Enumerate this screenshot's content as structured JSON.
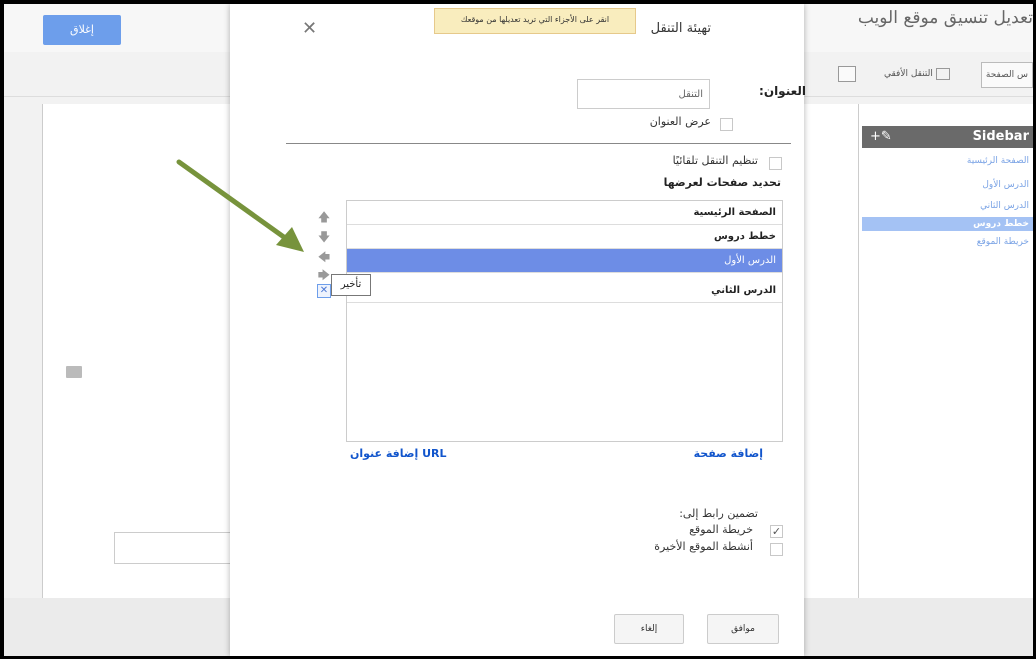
{
  "header": {
    "site_title": "تعديل تنسيق موقع الويب",
    "close_label": "إغلاق"
  },
  "toolbar": {
    "item_page": "س الصفحة",
    "item_horizontal_nav": "التنقل الأفقي"
  },
  "sidebar": {
    "title": "Sidebar",
    "tools": "+✎",
    "items": [
      "الصفحة الرئيسية",
      "الدرس الأول",
      "الدرس الثاني",
      "خطط دروس",
      "خريطة الموقع"
    ],
    "selected_index": 3
  },
  "dialog": {
    "tip": "انقر على الأجزاء التي تريد تعديلها من موقعك",
    "title": "تهيئة التنقل",
    "close_icon": "close-icon",
    "title_label": "العنوان:",
    "title_value": "التنقل",
    "show_title_label": "عرض العنوان",
    "auto_organize_label": "تنظيم التنقل تلقائيًا",
    "pages_label": "تحديد صفحات لعرضها",
    "pages": [
      "الصفحة الرئيسية",
      "خطط دروس",
      "الدرس الأول",
      "الدرس الثاني"
    ],
    "selected_page_index": 2,
    "tooltip": "تأخير",
    "add_page_link": "إضافة صفحة",
    "add_url_link": "إضافة عنوان URL",
    "include_link_label": "تضمين رابط إلى:",
    "include_options": [
      {
        "label": "خريطة الموقع",
        "checked": true
      },
      {
        "label": "أنشطة الموقع الأخيرة",
        "checked": false
      }
    ],
    "ok_label": "موافق",
    "cancel_label": "إلغاء"
  },
  "annotation": {
    "arrow_color": "#77933c",
    "selection_color": "#6d8de6",
    "link_color": "#1155cc"
  }
}
